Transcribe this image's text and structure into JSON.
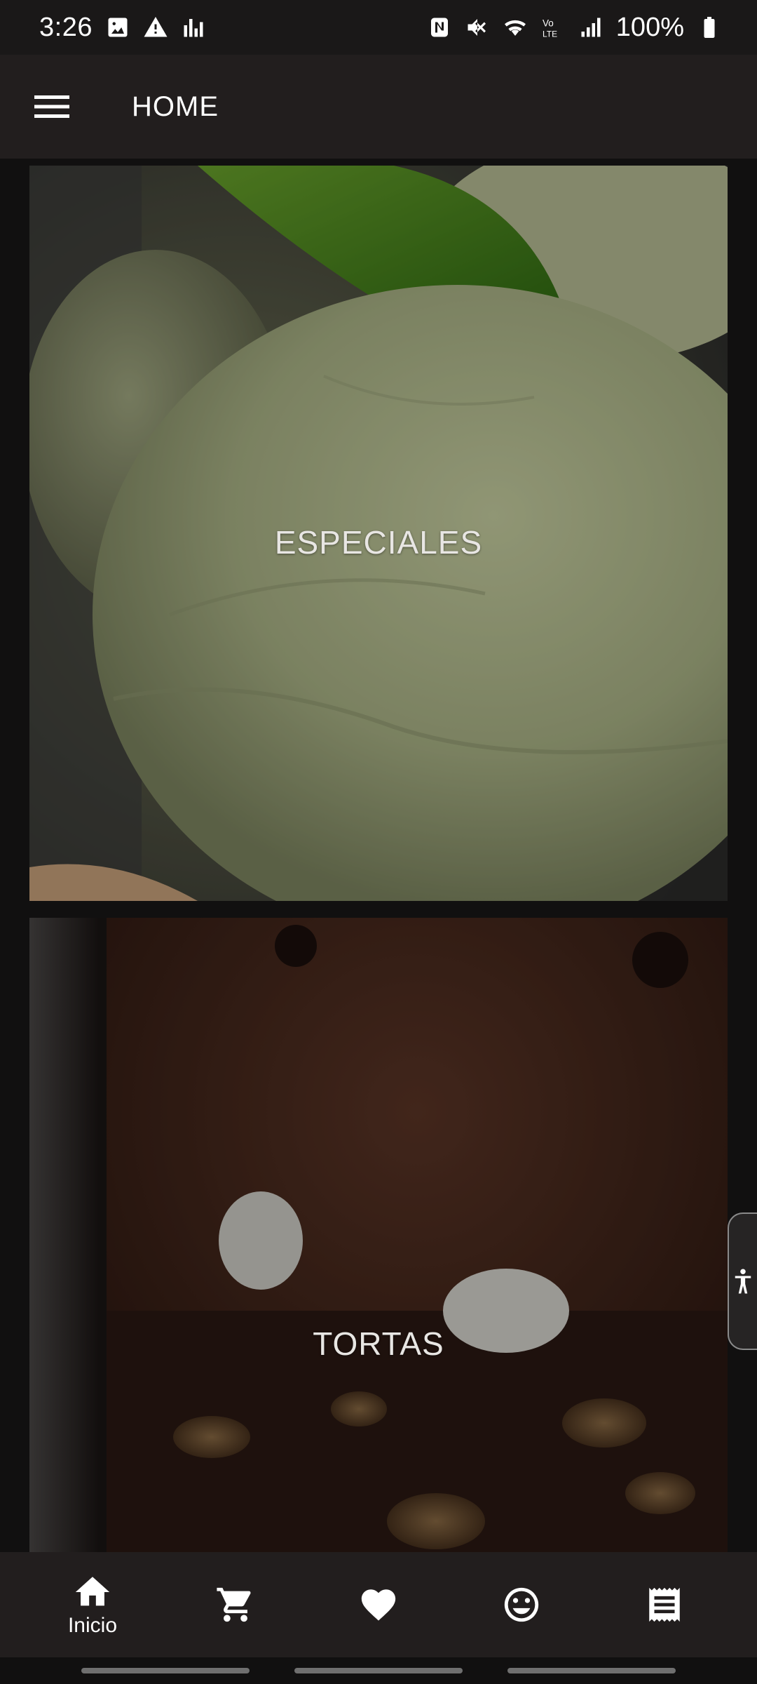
{
  "status_bar": {
    "time": "3:26",
    "battery": "100%",
    "left_icons": [
      "gallery-icon",
      "warning-icon",
      "chart-icon"
    ],
    "right_icons": [
      "nfc-icon",
      "mute-icon",
      "wifi-icon",
      "volte-icon",
      "signal-icon",
      "battery-icon"
    ]
  },
  "app_bar": {
    "title": "HOME",
    "menu_icon": "hamburger-menu-icon"
  },
  "cards": [
    {
      "label": "ESPECIALES",
      "image": "pistachio-ice-cream"
    },
    {
      "label": "TORTAS",
      "image": "chocolate-brownie-cake"
    }
  ],
  "bottom_nav": {
    "items": [
      {
        "label": "Inicio",
        "icon": "home-icon"
      },
      {
        "label": "",
        "icon": "cart-icon"
      },
      {
        "label": "",
        "icon": "heart-icon"
      },
      {
        "label": "",
        "icon": "smiley-icon"
      },
      {
        "label": "",
        "icon": "receipt-icon"
      }
    ]
  },
  "colors": {
    "app_bar_bg": "#221e1e",
    "content_bg": "#111010",
    "text": "#ffffff"
  }
}
